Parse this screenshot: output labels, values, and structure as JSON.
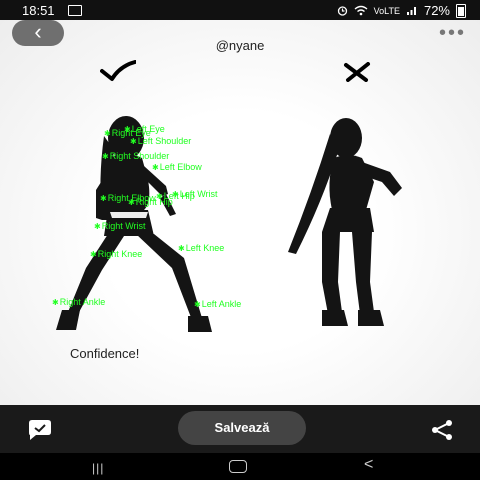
{
  "status_bar": {
    "time": "18:51",
    "battery": "72%",
    "network_label": "VoLTE",
    "icons": [
      "image-icon",
      "alarm-icon",
      "wifi-icon",
      "signal-icon",
      "battery-icon"
    ]
  },
  "header": {
    "back_icon": "‹",
    "handle": "@nyane",
    "more_icon": "•••"
  },
  "comparison": {
    "left_mark": "check-icon",
    "right_mark": "cross-icon"
  },
  "keypoints": [
    {
      "label": "Right Eye"
    },
    {
      "label": "Left Eye"
    },
    {
      "label": "Left Shoulder"
    },
    {
      "label": "Right Shoulder"
    },
    {
      "label": "Left Elbow"
    },
    {
      "label": "Right Elbow"
    },
    {
      "label": "Left Hip"
    },
    {
      "label": "Left Wrist"
    },
    {
      "label": "Right Hip"
    },
    {
      "label": "Right Wrist"
    },
    {
      "label": "Left Knee"
    },
    {
      "label": "Right Knee"
    },
    {
      "label": "Right Ankle"
    },
    {
      "label": "Left Ankle"
    }
  ],
  "caption": "Confidence!",
  "bottom_bar": {
    "save_label": "Salvează",
    "left_icon": "chat-icon",
    "right_icon": "share-icon"
  },
  "nav_bar": {
    "recent_glyph": "|||",
    "back_glyph": "<"
  },
  "colors": {
    "keypoint": "#22ff22",
    "bar_bg": "#1a1a1a",
    "button_bg": "#444444"
  }
}
